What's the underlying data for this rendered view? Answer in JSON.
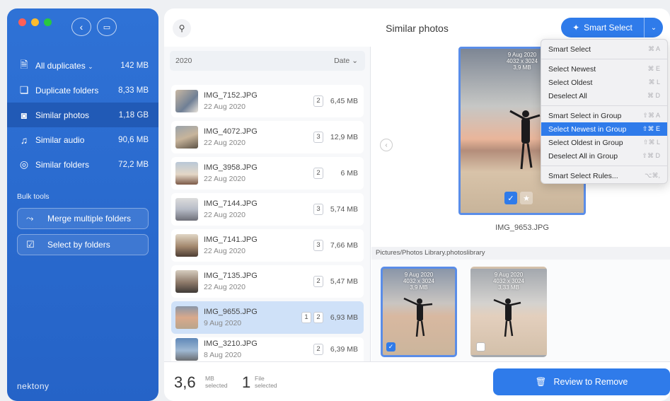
{
  "sidebar": {
    "items": [
      {
        "label": "All duplicates",
        "size": "142 MB",
        "icon": "document-icon"
      },
      {
        "label": "Duplicate folders",
        "size": "8,33 MB",
        "icon": "folders-icon"
      },
      {
        "label": "Similar photos",
        "size": "1,18 GB",
        "icon": "camera-icon"
      },
      {
        "label": "Similar audio",
        "size": "90,6 MB",
        "icon": "music-icon"
      },
      {
        "label": "Similar folders",
        "size": "72,2 MB",
        "icon": "folder-badge-icon"
      }
    ],
    "bulk_title": "Bulk tools",
    "merge_label": "Merge multiple folders",
    "select_label": "Select by folders",
    "brand": "nektony"
  },
  "header": {
    "title": "Similar photos",
    "smart_select": "Smart Select"
  },
  "list": {
    "year": "2020",
    "sort": "Date",
    "files": [
      {
        "name": "IMG_7152.JPG",
        "date": "22 Aug 2020",
        "count": "2",
        "size": "6,45 MB"
      },
      {
        "name": "IMG_4072.JPG",
        "date": "22 Aug 2020",
        "count": "3",
        "size": "12,9 MB"
      },
      {
        "name": "IMG_3958.JPG",
        "date": "22 Aug 2020",
        "count": "2",
        "size": "6 MB"
      },
      {
        "name": "IMG_7144.JPG",
        "date": "22 Aug 2020",
        "count": "3",
        "size": "5,74 MB"
      },
      {
        "name": "IMG_7141.JPG",
        "date": "22 Aug 2020",
        "count": "3",
        "size": "7,66 MB"
      },
      {
        "name": "IMG_7135.JPG",
        "date": "22 Aug 2020",
        "count": "2",
        "size": "5,47 MB"
      },
      {
        "name": "IMG_9655.JPG",
        "date": "9 Aug 2020",
        "selected_count": "1",
        "count": "2",
        "size": "6,93 MB"
      },
      {
        "name": "IMG_3210.JPG",
        "date": "8 Aug 2020",
        "count": "2",
        "size": "6,39 MB"
      }
    ]
  },
  "preview": {
    "meta_date": "9 Aug 2020",
    "meta_dims": "4032 x 3024",
    "meta_size": "3,9 MB",
    "caption": "IMG_9653.JPG",
    "path": "Pictures/Photos Library.photoslibrary",
    "group": [
      {
        "date": "9 Aug 2020",
        "dims": "4032 x 3024",
        "size": "3,9 MB"
      },
      {
        "date": "9 Aug 2020",
        "dims": "4032 x 3024",
        "size": "3,33 MB"
      }
    ]
  },
  "footer": {
    "size_num": "3,6",
    "size_unit": "MB",
    "size_lbl": "selected",
    "files_num": "1",
    "files_unit": "File",
    "files_lbl": "selected",
    "review": "Review to Remove"
  },
  "menu": {
    "items": [
      {
        "label": "Smart Select",
        "shortcut": "⌘ A"
      },
      {
        "label": "Select Newest",
        "shortcut": "⌘ E"
      },
      {
        "label": "Select Oldest",
        "shortcut": "⌘ L"
      },
      {
        "label": "Deselect All",
        "shortcut": "⌘ D"
      },
      {
        "label": "Smart Select in Group",
        "shortcut": "⇧⌘ A"
      },
      {
        "label": "Select Newest in Group",
        "shortcut": "⇧⌘ E"
      },
      {
        "label": "Select Oldest in Group",
        "shortcut": "⇧⌘ L"
      },
      {
        "label": "Deselect All in Group",
        "shortcut": "⇧⌘ D"
      },
      {
        "label": "Smart Select Rules...",
        "shortcut": "⌥⌘,"
      }
    ]
  },
  "colors": {
    "accent": "#2f7bea",
    "sidebar": "#2f72d6"
  }
}
